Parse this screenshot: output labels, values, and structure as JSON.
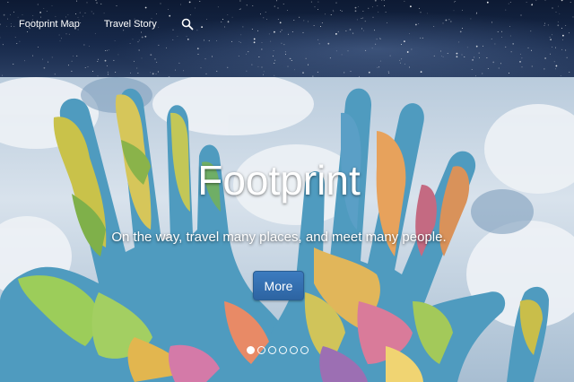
{
  "nav": {
    "links": [
      {
        "label": "Footprint Map"
      },
      {
        "label": "Travel Story"
      }
    ],
    "search_icon": "search-icon"
  },
  "hero": {
    "title": "Footprint",
    "subtitle": "On the way, travel many places, and meet many people.",
    "button_label": "More",
    "background_image": "hands-painted-with-world-map-against-cloudy-sky",
    "carousel": {
      "slide_count": 6,
      "active_index": 0
    }
  },
  "colors": {
    "nav_background": "#13244a",
    "button": "#3070b2",
    "text": "#ffffff"
  }
}
